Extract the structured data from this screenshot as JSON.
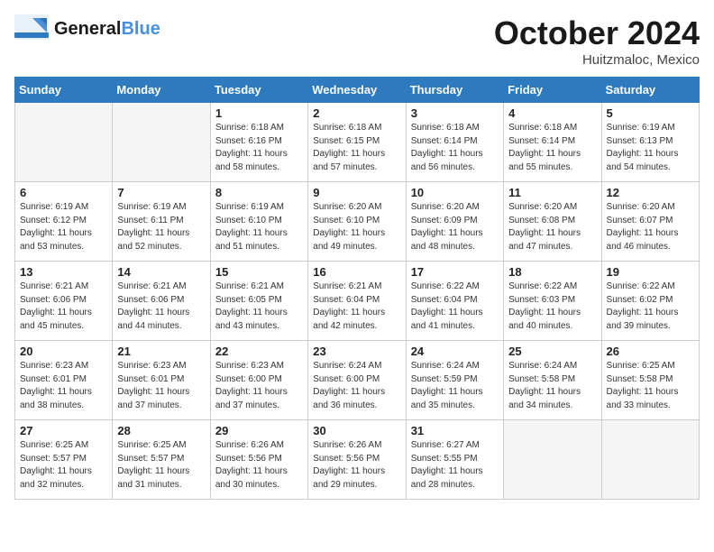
{
  "header": {
    "logo_line1": "General",
    "logo_line2": "Blue",
    "month": "October 2024",
    "location": "Huitzmaloc, Mexico"
  },
  "days_of_week": [
    "Sunday",
    "Monday",
    "Tuesday",
    "Wednesday",
    "Thursday",
    "Friday",
    "Saturday"
  ],
  "weeks": [
    [
      {
        "day": null
      },
      {
        "day": null
      },
      {
        "day": 1,
        "sunrise": "6:18 AM",
        "sunset": "6:16 PM",
        "daylight": "11 hours and 58 minutes."
      },
      {
        "day": 2,
        "sunrise": "6:18 AM",
        "sunset": "6:15 PM",
        "daylight": "11 hours and 57 minutes."
      },
      {
        "day": 3,
        "sunrise": "6:18 AM",
        "sunset": "6:14 PM",
        "daylight": "11 hours and 56 minutes."
      },
      {
        "day": 4,
        "sunrise": "6:18 AM",
        "sunset": "6:14 PM",
        "daylight": "11 hours and 55 minutes."
      },
      {
        "day": 5,
        "sunrise": "6:19 AM",
        "sunset": "6:13 PM",
        "daylight": "11 hours and 54 minutes."
      }
    ],
    [
      {
        "day": 6,
        "sunrise": "6:19 AM",
        "sunset": "6:12 PM",
        "daylight": "11 hours and 53 minutes."
      },
      {
        "day": 7,
        "sunrise": "6:19 AM",
        "sunset": "6:11 PM",
        "daylight": "11 hours and 52 minutes."
      },
      {
        "day": 8,
        "sunrise": "6:19 AM",
        "sunset": "6:10 PM",
        "daylight": "11 hours and 51 minutes."
      },
      {
        "day": 9,
        "sunrise": "6:20 AM",
        "sunset": "6:10 PM",
        "daylight": "11 hours and 49 minutes."
      },
      {
        "day": 10,
        "sunrise": "6:20 AM",
        "sunset": "6:09 PM",
        "daylight": "11 hours and 48 minutes."
      },
      {
        "day": 11,
        "sunrise": "6:20 AM",
        "sunset": "6:08 PM",
        "daylight": "11 hours and 47 minutes."
      },
      {
        "day": 12,
        "sunrise": "6:20 AM",
        "sunset": "6:07 PM",
        "daylight": "11 hours and 46 minutes."
      }
    ],
    [
      {
        "day": 13,
        "sunrise": "6:21 AM",
        "sunset": "6:06 PM",
        "daylight": "11 hours and 45 minutes."
      },
      {
        "day": 14,
        "sunrise": "6:21 AM",
        "sunset": "6:06 PM",
        "daylight": "11 hours and 44 minutes."
      },
      {
        "day": 15,
        "sunrise": "6:21 AM",
        "sunset": "6:05 PM",
        "daylight": "11 hours and 43 minutes."
      },
      {
        "day": 16,
        "sunrise": "6:21 AM",
        "sunset": "6:04 PM",
        "daylight": "11 hours and 42 minutes."
      },
      {
        "day": 17,
        "sunrise": "6:22 AM",
        "sunset": "6:04 PM",
        "daylight": "11 hours and 41 minutes."
      },
      {
        "day": 18,
        "sunrise": "6:22 AM",
        "sunset": "6:03 PM",
        "daylight": "11 hours and 40 minutes."
      },
      {
        "day": 19,
        "sunrise": "6:22 AM",
        "sunset": "6:02 PM",
        "daylight": "11 hours and 39 minutes."
      }
    ],
    [
      {
        "day": 20,
        "sunrise": "6:23 AM",
        "sunset": "6:01 PM",
        "daylight": "11 hours and 38 minutes."
      },
      {
        "day": 21,
        "sunrise": "6:23 AM",
        "sunset": "6:01 PM",
        "daylight": "11 hours and 37 minutes."
      },
      {
        "day": 22,
        "sunrise": "6:23 AM",
        "sunset": "6:00 PM",
        "daylight": "11 hours and 37 minutes."
      },
      {
        "day": 23,
        "sunrise": "6:24 AM",
        "sunset": "6:00 PM",
        "daylight": "11 hours and 36 minutes."
      },
      {
        "day": 24,
        "sunrise": "6:24 AM",
        "sunset": "5:59 PM",
        "daylight": "11 hours and 35 minutes."
      },
      {
        "day": 25,
        "sunrise": "6:24 AM",
        "sunset": "5:58 PM",
        "daylight": "11 hours and 34 minutes."
      },
      {
        "day": 26,
        "sunrise": "6:25 AM",
        "sunset": "5:58 PM",
        "daylight": "11 hours and 33 minutes."
      }
    ],
    [
      {
        "day": 27,
        "sunrise": "6:25 AM",
        "sunset": "5:57 PM",
        "daylight": "11 hours and 32 minutes."
      },
      {
        "day": 28,
        "sunrise": "6:25 AM",
        "sunset": "5:57 PM",
        "daylight": "11 hours and 31 minutes."
      },
      {
        "day": 29,
        "sunrise": "6:26 AM",
        "sunset": "5:56 PM",
        "daylight": "11 hours and 30 minutes."
      },
      {
        "day": 30,
        "sunrise": "6:26 AM",
        "sunset": "5:56 PM",
        "daylight": "11 hours and 29 minutes."
      },
      {
        "day": 31,
        "sunrise": "6:27 AM",
        "sunset": "5:55 PM",
        "daylight": "11 hours and 28 minutes."
      },
      {
        "day": null
      },
      {
        "day": null
      }
    ]
  ],
  "labels": {
    "sunrise_prefix": "Sunrise: ",
    "sunset_prefix": "Sunset: ",
    "daylight_prefix": "Daylight: "
  }
}
